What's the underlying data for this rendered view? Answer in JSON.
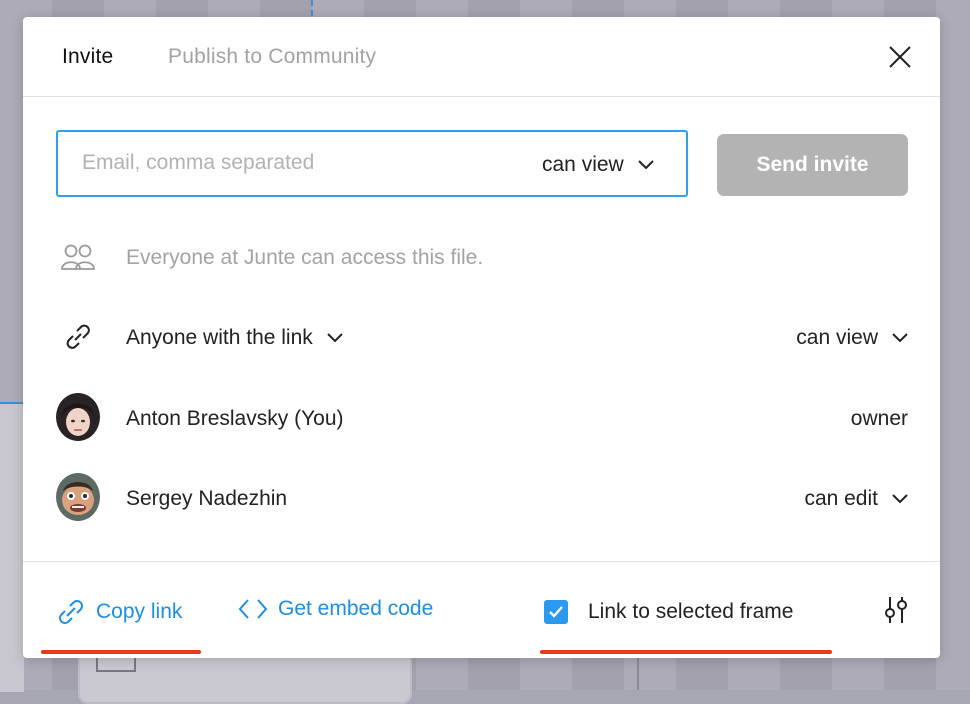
{
  "tabs": {
    "invite": "Invite",
    "publish": "Publish to Community"
  },
  "invite": {
    "email_placeholder": "Email, comma separated",
    "email_value": "",
    "permission": "can view",
    "send_label": "Send invite"
  },
  "access_note": "Everyone at Junte can access this file.",
  "link_access": {
    "label": "Anyone with the link",
    "permission": "can view"
  },
  "people": [
    {
      "name": "Anton Breslavsky (You)",
      "role": "owner"
    },
    {
      "name": "Sergey Nadezhin",
      "role": "can edit"
    }
  ],
  "footer": {
    "copy_link": "Copy link",
    "embed": "Get embed code",
    "link_frame": "Link to selected frame",
    "link_frame_checked": true
  },
  "colors": {
    "accent": "#2b99ef",
    "link": "#1a8fe8",
    "annotation": "#e8391c",
    "disabled_button": "#b3b3b3"
  },
  "icons": [
    "close-icon",
    "chevron-down-icon",
    "people-icon",
    "link-icon",
    "code-icon",
    "check-icon",
    "settings-sliders-icon"
  ]
}
